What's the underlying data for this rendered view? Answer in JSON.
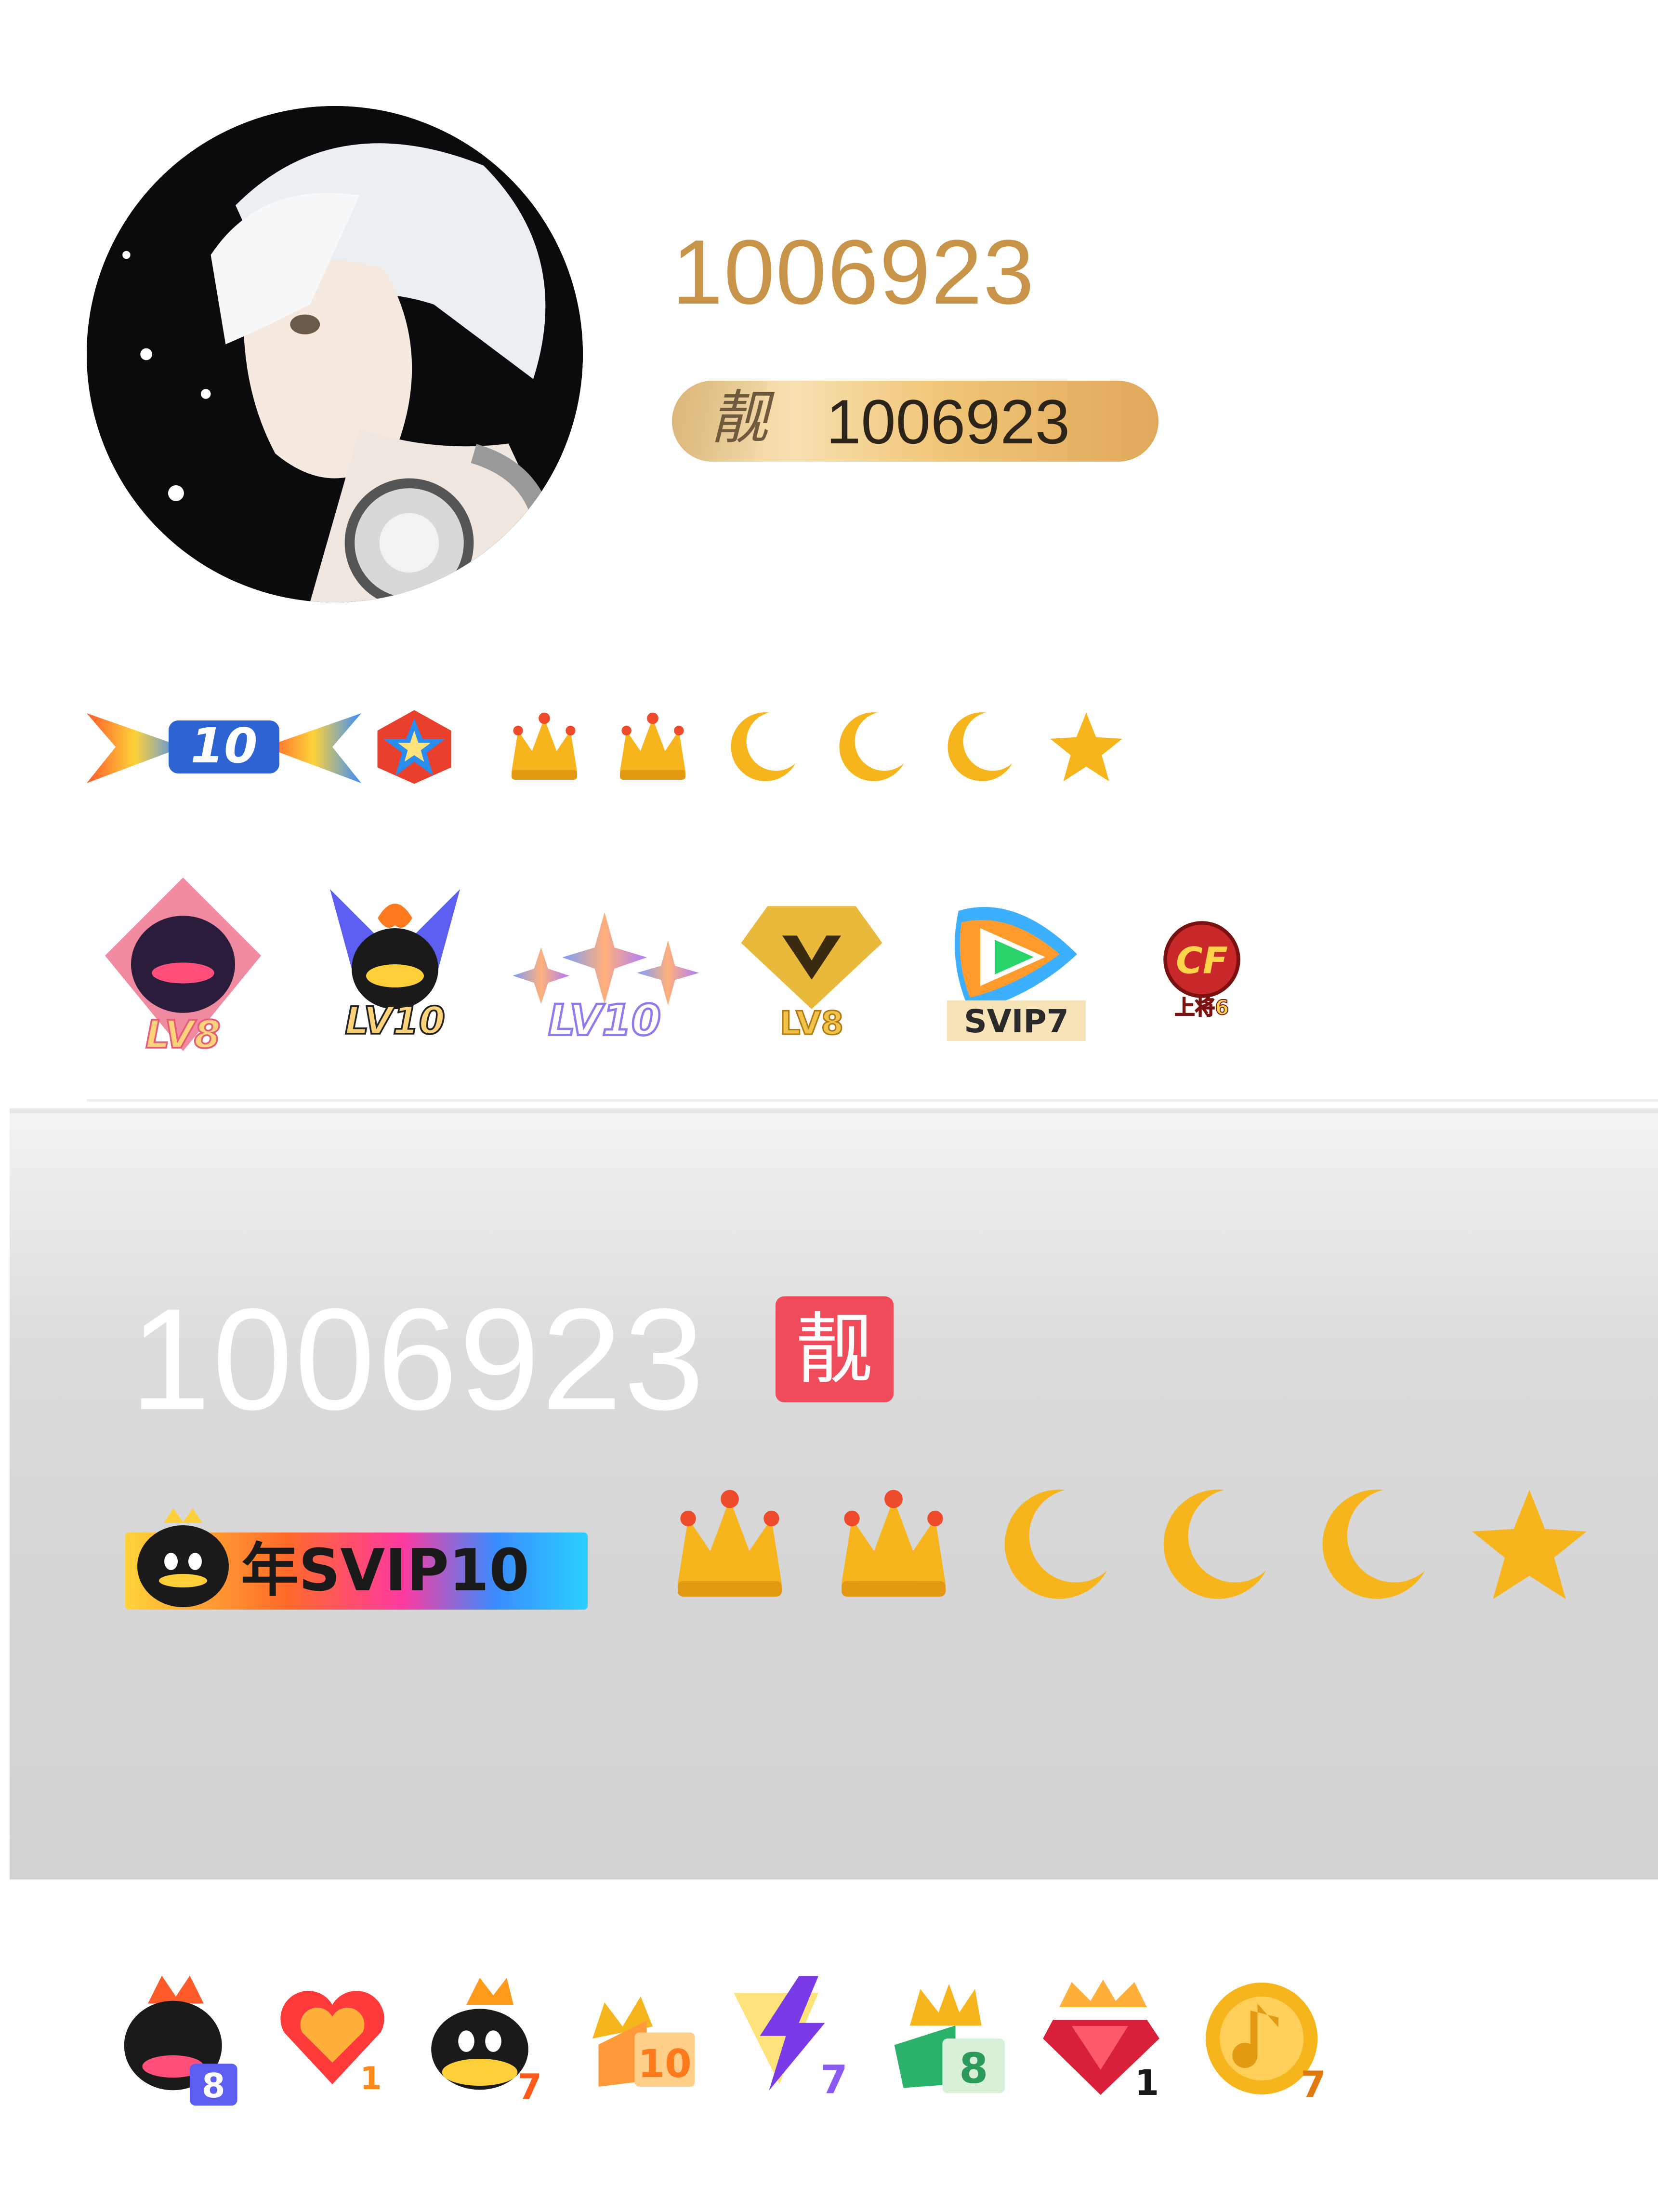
{
  "profile": {
    "nickname": "1006923",
    "pretty_id_mark": "靓",
    "pretty_id": "1006923"
  },
  "level_badges": {
    "level_number": "10",
    "icons": [
      "level-crown-icon",
      "level-crown-icon",
      "level-moon-icon",
      "level-moon-icon",
      "level-moon-icon",
      "level-star-icon"
    ]
  },
  "vip_badges": [
    {
      "icon": "qq-vip-lv8-icon",
      "label": "LV8"
    },
    {
      "icon": "super-vip-lv10-icon",
      "label": "LV10"
    },
    {
      "icon": "star-vip-lv10-icon",
      "label": "LV10"
    },
    {
      "icon": "gold-diamond-lv8-icon",
      "label": "LV8"
    },
    {
      "icon": "video-svip7-icon",
      "label": "SVIP7"
    },
    {
      "icon": "cf-rank-icon",
      "label": "上将6"
    }
  ],
  "gray_card": {
    "name": "1006923",
    "tag": "靓",
    "svip_label": "年SVIP10"
  },
  "bottom_badges": [
    {
      "icon": "penguin-8-icon",
      "num": "8"
    },
    {
      "icon": "heart-1-icon",
      "num": "1"
    },
    {
      "icon": "penguin-7-icon",
      "num": "7"
    },
    {
      "icon": "crown-10-icon",
      "num": "10"
    },
    {
      "icon": "lightning-7-icon",
      "num": "7"
    },
    {
      "icon": "green-crown-8-icon",
      "num": "8"
    },
    {
      "icon": "ruby-1-icon",
      "num": "1"
    },
    {
      "icon": "music-7-icon",
      "num": "7"
    }
  ],
  "colors": {
    "nickname": "#c7944a",
    "gold": "#f6b51c",
    "tag_red": "#ef4b5b"
  }
}
